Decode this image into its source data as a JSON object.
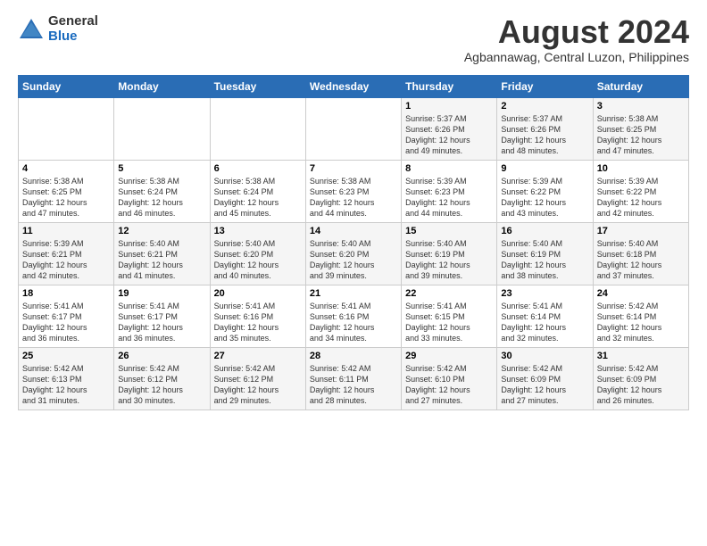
{
  "logo": {
    "general": "General",
    "blue": "Blue"
  },
  "title": "August 2024",
  "subtitle": "Agbannawag, Central Luzon, Philippines",
  "days_of_week": [
    "Sunday",
    "Monday",
    "Tuesday",
    "Wednesday",
    "Thursday",
    "Friday",
    "Saturday"
  ],
  "weeks": [
    [
      {
        "day": "",
        "info": ""
      },
      {
        "day": "",
        "info": ""
      },
      {
        "day": "",
        "info": ""
      },
      {
        "day": "",
        "info": ""
      },
      {
        "day": "1",
        "info": "Sunrise: 5:37 AM\nSunset: 6:26 PM\nDaylight: 12 hours\nand 49 minutes."
      },
      {
        "day": "2",
        "info": "Sunrise: 5:37 AM\nSunset: 6:26 PM\nDaylight: 12 hours\nand 48 minutes."
      },
      {
        "day": "3",
        "info": "Sunrise: 5:38 AM\nSunset: 6:25 PM\nDaylight: 12 hours\nand 47 minutes."
      }
    ],
    [
      {
        "day": "4",
        "info": "Sunrise: 5:38 AM\nSunset: 6:25 PM\nDaylight: 12 hours\nand 47 minutes."
      },
      {
        "day": "5",
        "info": "Sunrise: 5:38 AM\nSunset: 6:24 PM\nDaylight: 12 hours\nand 46 minutes."
      },
      {
        "day": "6",
        "info": "Sunrise: 5:38 AM\nSunset: 6:24 PM\nDaylight: 12 hours\nand 45 minutes."
      },
      {
        "day": "7",
        "info": "Sunrise: 5:38 AM\nSunset: 6:23 PM\nDaylight: 12 hours\nand 44 minutes."
      },
      {
        "day": "8",
        "info": "Sunrise: 5:39 AM\nSunset: 6:23 PM\nDaylight: 12 hours\nand 44 minutes."
      },
      {
        "day": "9",
        "info": "Sunrise: 5:39 AM\nSunset: 6:22 PM\nDaylight: 12 hours\nand 43 minutes."
      },
      {
        "day": "10",
        "info": "Sunrise: 5:39 AM\nSunset: 6:22 PM\nDaylight: 12 hours\nand 42 minutes."
      }
    ],
    [
      {
        "day": "11",
        "info": "Sunrise: 5:39 AM\nSunset: 6:21 PM\nDaylight: 12 hours\nand 42 minutes."
      },
      {
        "day": "12",
        "info": "Sunrise: 5:40 AM\nSunset: 6:21 PM\nDaylight: 12 hours\nand 41 minutes."
      },
      {
        "day": "13",
        "info": "Sunrise: 5:40 AM\nSunset: 6:20 PM\nDaylight: 12 hours\nand 40 minutes."
      },
      {
        "day": "14",
        "info": "Sunrise: 5:40 AM\nSunset: 6:20 PM\nDaylight: 12 hours\nand 39 minutes."
      },
      {
        "day": "15",
        "info": "Sunrise: 5:40 AM\nSunset: 6:19 PM\nDaylight: 12 hours\nand 39 minutes."
      },
      {
        "day": "16",
        "info": "Sunrise: 5:40 AM\nSunset: 6:19 PM\nDaylight: 12 hours\nand 38 minutes."
      },
      {
        "day": "17",
        "info": "Sunrise: 5:40 AM\nSunset: 6:18 PM\nDaylight: 12 hours\nand 37 minutes."
      }
    ],
    [
      {
        "day": "18",
        "info": "Sunrise: 5:41 AM\nSunset: 6:17 PM\nDaylight: 12 hours\nand 36 minutes."
      },
      {
        "day": "19",
        "info": "Sunrise: 5:41 AM\nSunset: 6:17 PM\nDaylight: 12 hours\nand 36 minutes."
      },
      {
        "day": "20",
        "info": "Sunrise: 5:41 AM\nSunset: 6:16 PM\nDaylight: 12 hours\nand 35 minutes."
      },
      {
        "day": "21",
        "info": "Sunrise: 5:41 AM\nSunset: 6:16 PM\nDaylight: 12 hours\nand 34 minutes."
      },
      {
        "day": "22",
        "info": "Sunrise: 5:41 AM\nSunset: 6:15 PM\nDaylight: 12 hours\nand 33 minutes."
      },
      {
        "day": "23",
        "info": "Sunrise: 5:41 AM\nSunset: 6:14 PM\nDaylight: 12 hours\nand 32 minutes."
      },
      {
        "day": "24",
        "info": "Sunrise: 5:42 AM\nSunset: 6:14 PM\nDaylight: 12 hours\nand 32 minutes."
      }
    ],
    [
      {
        "day": "25",
        "info": "Sunrise: 5:42 AM\nSunset: 6:13 PM\nDaylight: 12 hours\nand 31 minutes."
      },
      {
        "day": "26",
        "info": "Sunrise: 5:42 AM\nSunset: 6:12 PM\nDaylight: 12 hours\nand 30 minutes."
      },
      {
        "day": "27",
        "info": "Sunrise: 5:42 AM\nSunset: 6:12 PM\nDaylight: 12 hours\nand 29 minutes."
      },
      {
        "day": "28",
        "info": "Sunrise: 5:42 AM\nSunset: 6:11 PM\nDaylight: 12 hours\nand 28 minutes."
      },
      {
        "day": "29",
        "info": "Sunrise: 5:42 AM\nSunset: 6:10 PM\nDaylight: 12 hours\nand 27 minutes."
      },
      {
        "day": "30",
        "info": "Sunrise: 5:42 AM\nSunset: 6:09 PM\nDaylight: 12 hours\nand 27 minutes."
      },
      {
        "day": "31",
        "info": "Sunrise: 5:42 AM\nSunset: 6:09 PM\nDaylight: 12 hours\nand 26 minutes."
      }
    ]
  ]
}
